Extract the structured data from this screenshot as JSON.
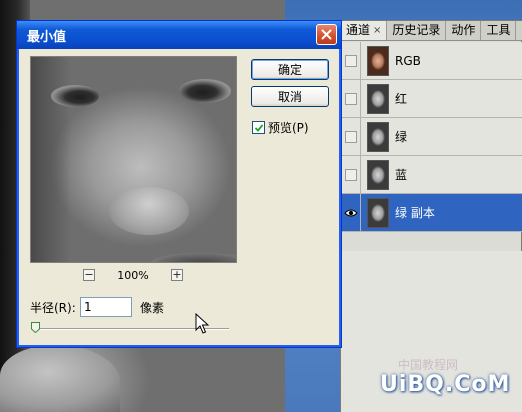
{
  "dialog": {
    "title": "最小值",
    "ok_label": "确定",
    "cancel_label": "取消",
    "preview_label": "预览(P)",
    "preview_checked": true,
    "zoom": "100%",
    "zoom_out": "−",
    "zoom_in": "+",
    "radius_label": "半径(R):",
    "radius_value": "1",
    "radius_unit": "像素",
    "radius_slider_fraction": 0.01
  },
  "panel": {
    "tabs": [
      {
        "label": "通道",
        "active": true,
        "close": "×"
      },
      {
        "label": "历史记录",
        "active": false
      },
      {
        "label": "动作",
        "active": false
      },
      {
        "label": "工具",
        "active": false
      }
    ],
    "channels": [
      {
        "name": "RGB",
        "visible": false,
        "selected": false
      },
      {
        "name": "红",
        "visible": false,
        "selected": false
      },
      {
        "name": "绿",
        "visible": false,
        "selected": false
      },
      {
        "name": "蓝",
        "visible": false,
        "selected": false
      },
      {
        "name": "绿 副本",
        "visible": true,
        "selected": true
      }
    ]
  },
  "watermark": {
    "text": "UiBQ.CoM",
    "cn": "中国教程网"
  },
  "colors": {
    "titlebar": "#0a4fd0",
    "selected_row": "#2f65c1",
    "dialog_bg": "#ece9d8"
  }
}
